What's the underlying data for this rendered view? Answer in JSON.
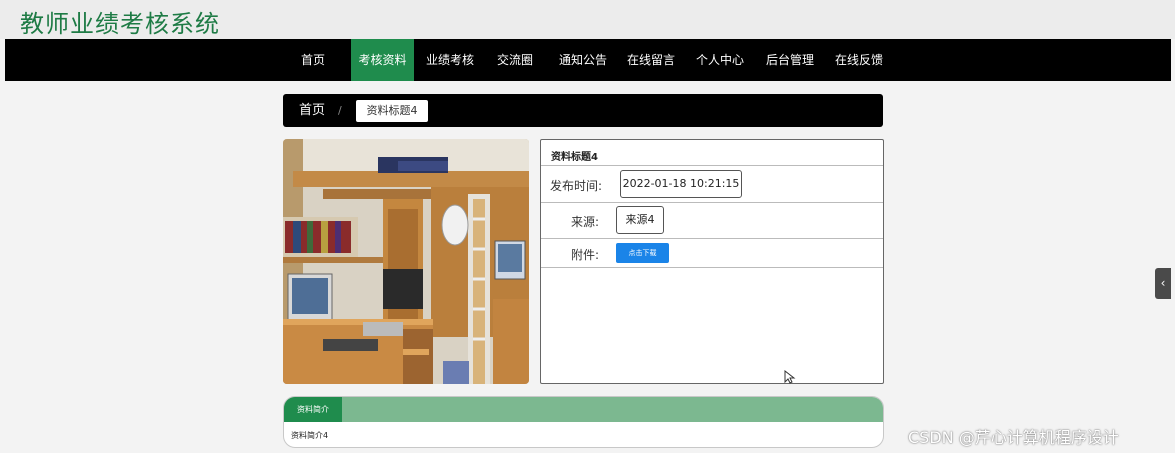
{
  "header": {
    "title": "教师业绩考核系统"
  },
  "nav": {
    "items": [
      {
        "label": "首页"
      },
      {
        "label": "考核资料"
      },
      {
        "label": "业绩考核"
      },
      {
        "label": "交流圈"
      },
      {
        "label": "通知公告"
      },
      {
        "label": "在线留言"
      },
      {
        "label": "个人中心"
      },
      {
        "label": "后台管理"
      },
      {
        "label": "在线反馈"
      }
    ],
    "active_index": 1
  },
  "breadcrumb": {
    "home": "首页",
    "separator": "/",
    "current": "资料标题4"
  },
  "detail": {
    "title": "资料标题4",
    "publish_time_label": "发布时间:",
    "publish_time_value": "2022-01-18 10:21:15",
    "source_label": "来源:",
    "source_value": "来源4",
    "attachment_label": "附件:",
    "download_label": "点击下载"
  },
  "intro": {
    "tab_label": "资料简介",
    "text": "资料简介4"
  },
  "side_tab": {
    "icon": "chevron-left-icon",
    "glyph": "‹"
  },
  "watermark": "CSDN @芹心计算机程序设计",
  "colors": {
    "brand_green": "#1f8c4d",
    "title_green": "#1e7b45",
    "nav_black": "#000000",
    "link_blue": "#1a84e8",
    "intro_bar": "#7cb890"
  }
}
